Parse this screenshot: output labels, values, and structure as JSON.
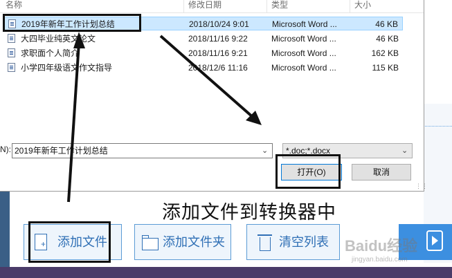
{
  "dialog": {
    "columns": [
      "名称",
      "修改日期",
      "类型",
      "大小"
    ],
    "files": [
      {
        "name": "2019年新年工作计划总结",
        "modified": "2018/10/24 9:01",
        "type": "Microsoft Word ...",
        "size": "46 KB"
      },
      {
        "name": "大四毕业纯英文论文",
        "modified": "2018/11/16 9:22",
        "type": "Microsoft Word ...",
        "size": "46 KB"
      },
      {
        "name": "求职面个人简介",
        "modified": "2018/11/16 9:21",
        "type": "Microsoft Word ...",
        "size": "162 KB"
      },
      {
        "name": "小学四年级语文作文指导",
        "modified": "2018/12/6 11:16",
        "type": "Microsoft Word ...",
        "size": "115 KB"
      }
    ],
    "filename_label": "N):",
    "filename_value": "2019年新年工作计划总结",
    "filetype_value": "*.doc;*.docx",
    "open_label": "打开(O)",
    "cancel_label": "取消"
  },
  "caption": "添加文件到转换器中",
  "toolbar": {
    "add_file": "添加文件",
    "add_folder": "添加文件夹",
    "clear_list": "清空列表"
  },
  "watermark": {
    "text": "Baidu经验",
    "sub": "jingyan.baidu.com"
  },
  "colors": {
    "accent": "#2f6fb5",
    "selection": "#cce8ff",
    "convert": "#3c8fe0"
  }
}
